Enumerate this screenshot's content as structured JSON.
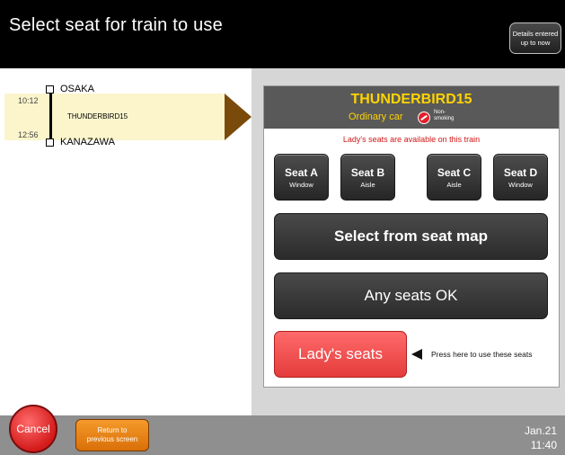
{
  "header": {
    "title": "Select seat for train to use",
    "details_button": "Details entered\nup to now"
  },
  "route": {
    "departure_station": "OSAKA",
    "arrival_station": "KANAZAWA",
    "departure_time": "10:12",
    "arrival_time": "12:56",
    "train_name": "THUNDERBIRD15"
  },
  "card": {
    "train_name": "THUNDERBIRD15",
    "car_type": "Ordinary car",
    "smoking_label": "Non-\nsmoking",
    "notice": "Lady's seats are available on this train",
    "seats": [
      {
        "label": "Seat A",
        "position": "Window"
      },
      {
        "label": "Seat B",
        "position": "Aisle"
      },
      {
        "label": "Seat C",
        "position": "Aisle"
      },
      {
        "label": "Seat D",
        "position": "Window"
      }
    ],
    "seat_map_button": "Select from seat map",
    "any_seat_button": "Any seats OK",
    "lady_button": "Lady's seats",
    "lady_hint": "Press here to use these seats"
  },
  "footer": {
    "cancel_button": "Cancel",
    "return_button": "Return to\nprevious screen",
    "date": "Jan.21",
    "time": "11:40"
  },
  "colors": {
    "header_bg": "#000000",
    "accent_yellow": "#ffd400",
    "route_band": "#fcf5cc",
    "lady_red": "#e43c3c",
    "cancel_red": "#d41b1b",
    "return_orange": "#d96f08"
  }
}
